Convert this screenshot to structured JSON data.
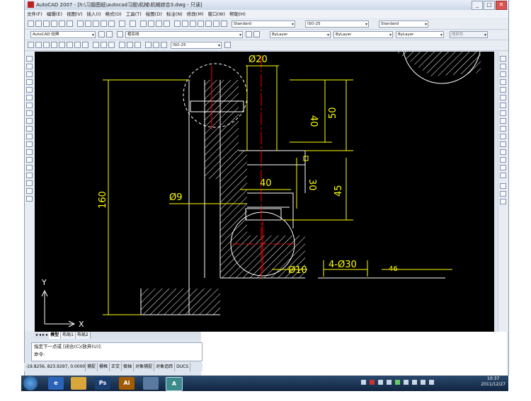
{
  "window": {
    "title": "AutoCAD 2007 - [h:\\习题图纸\\autocad习题\\机械\\机械综合3.dwg - 只读]",
    "minimize": "_",
    "maximize": "□",
    "close": "✕"
  },
  "menu": [
    "文件(F)",
    "编辑(E)",
    "视图(V)",
    "插入(I)",
    "格式(O)",
    "工具(T)",
    "绘图(D)",
    "标注(N)",
    "修改(M)",
    "窗口(W)",
    "帮助(H)"
  ],
  "toolbar": {
    "text_style": "Standard",
    "dim_style": "ISO-25",
    "table_style": "Standard",
    "workspace": "AutoCAD 经典",
    "layer": "粗实线",
    "color": "ByLayer",
    "linetype": "ByLayer",
    "lineweight": "ByLayer",
    "plotstyle": "随颜色",
    "dim_style2": "ISO-25"
  },
  "drawing": {
    "dims": {
      "d20": "Ø20",
      "d40v": "40",
      "d50": "50",
      "d40h": "40",
      "d30": "30",
      "d45": "45",
      "d160": "160",
      "d9": "Ø9",
      "d10": "Ø10",
      "d4x30": "4-Ø30",
      "partial": "46"
    },
    "ucs": {
      "y": "Y",
      "x": "X"
    }
  },
  "tabs": [
    "模型",
    "布局1",
    "布局2"
  ],
  "command": {
    "line1": "指定下一点或 [闭合(C)/放弃(U)]:",
    "line2": "命令:"
  },
  "status": {
    "coords": "-19.8256, 823.9297, 0.0000",
    "buttons": [
      "捕捉",
      "栅格",
      "正交",
      "极轴",
      "对象捕捉",
      "对象追踪",
      "DUCS"
    ]
  },
  "taskbar": {
    "apps": [
      "Ps",
      "Ai"
    ],
    "time": "10:37",
    "date": "2011/12/27"
  },
  "colors": {
    "yellow": "#ffff00",
    "red": "#ff0000",
    "white": "#ffffff"
  }
}
